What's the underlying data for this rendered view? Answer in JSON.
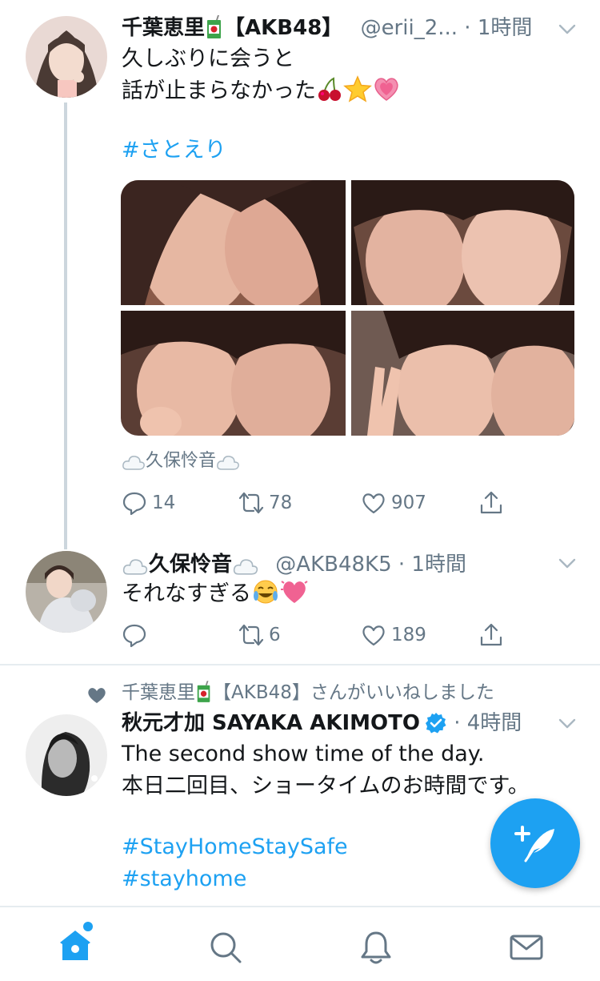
{
  "tweets": [
    {
      "name": "千葉恵里🧃【AKB48】",
      "name_prefix": "千葉恵里",
      "name_suffix": "【AKB48】",
      "handle": "@erii_2...",
      "time": "· 1時間",
      "lines": [
        "久しぶりに会うと",
        "話が止まらなかった🍒⭐💗"
      ],
      "line1": "久しぶりに会うと",
      "line2": "話が止まらなかった",
      "hashtag": "#さとえり",
      "photo_tag": "☁️久保怜音☁️",
      "photo_tag_text": "久保怜音",
      "replies": "14",
      "retweets": "78",
      "likes": "907"
    },
    {
      "name": "☁️久保怜音☁️",
      "name_text": "久保怜音",
      "handle": "@AKB48K5",
      "time": "· 1時間",
      "text": "それなすぎる😂💓",
      "text_plain": "それなすぎる",
      "replies": "",
      "retweets": "6",
      "likes": "189"
    },
    {
      "social_context": "千葉恵里🧃【AKB48】さんがいいねしました",
      "social_prefix": "千葉恵里",
      "social_suffix": "【AKB48】さんがいいねしました",
      "name": "秋元才加 SAYAKA AKIMOTO",
      "verified": true,
      "time": "· 4時間",
      "line1": "The second show time of the day.",
      "line2": "本日二回目、ショータイムのお時間です。",
      "hashtag1": "#StayHomeStaySafe",
      "hashtag2": "#stayhome"
    }
  ],
  "tabs": [
    "home-icon",
    "search-icon",
    "notifications-icon",
    "messages-icon"
  ],
  "colors": {
    "accent": "#1da1f2",
    "secondary_text": "#657786",
    "divider": "#e6ecf0"
  }
}
